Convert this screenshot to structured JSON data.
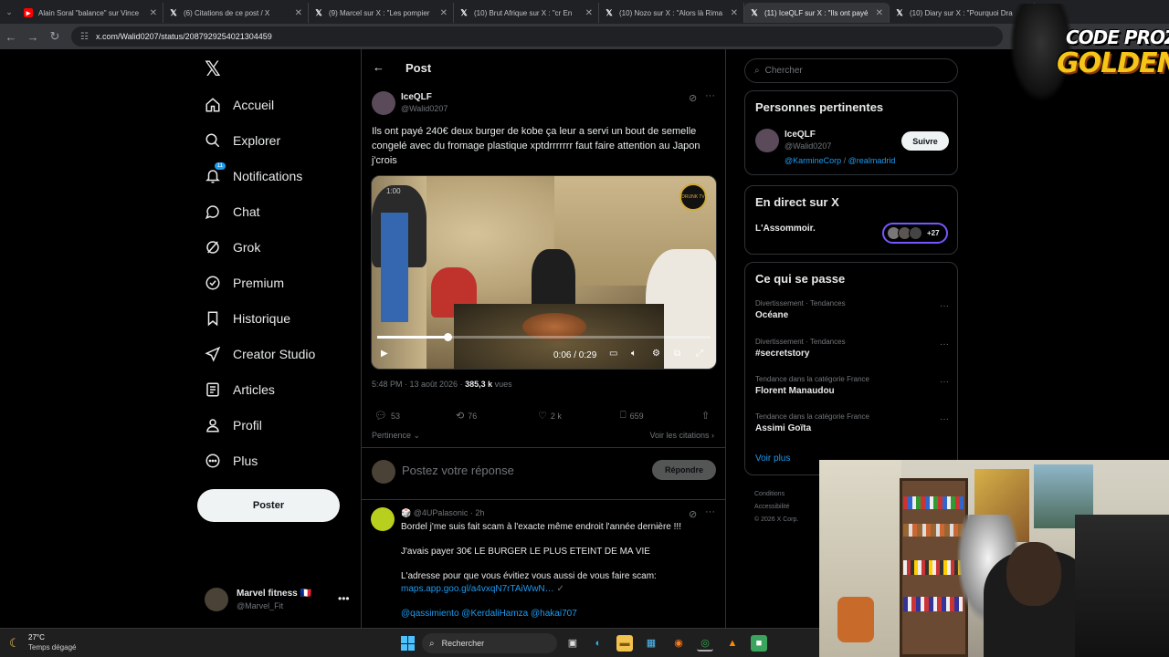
{
  "browser": {
    "tabs": [
      {
        "icon": "youtube-icon",
        "title": "Alain Soral \"balance\" sur Vince"
      },
      {
        "icon": "x-icon",
        "title": "(6) Citations de ce post / X"
      },
      {
        "icon": "x-icon",
        "title": "(9) Marcel sur X : \"Les pompier"
      },
      {
        "icon": "x-icon",
        "title": "(10) Brut Afrique sur X : \"cr En"
      },
      {
        "icon": "x-icon",
        "title": "(10) Nozo sur X : \"Alors là Rima"
      },
      {
        "icon": "x-icon",
        "title": "(11) IceQLF sur X : \"Ils ont payé",
        "active": true
      },
      {
        "icon": "x-icon",
        "title": "(10) Diary sur X : \"Pourquoi Dra"
      }
    ],
    "url": "x.com/Walid0207/status/2087929254021304459"
  },
  "nav": {
    "items": [
      {
        "label": "Accueil",
        "icon": "home-icon"
      },
      {
        "label": "Explorer",
        "icon": "search-icon"
      },
      {
        "label": "Notifications",
        "icon": "bell-icon",
        "badge": "11"
      },
      {
        "label": "Chat",
        "icon": "chat-icon"
      },
      {
        "label": "Grok",
        "icon": "grok-icon"
      },
      {
        "label": "Premium",
        "icon": "verified-icon"
      },
      {
        "label": "Historique",
        "icon": "bookmark-icon"
      },
      {
        "label": "Creator Studio",
        "icon": "rocket-icon"
      },
      {
        "label": "Articles",
        "icon": "article-icon"
      },
      {
        "label": "Profil",
        "icon": "person-icon"
      },
      {
        "label": "Plus",
        "icon": "more-circle-icon"
      }
    ],
    "post_button": "Poster",
    "account": {
      "name": "Marvel fitness 🇫🇷",
      "handle": "@Marvel_Fit"
    }
  },
  "post": {
    "header_title": "Post",
    "author": {
      "name": "IceQLF",
      "handle": "@Walid0207"
    },
    "text": "Ils ont payé 240€ deux burger de kobe ça leur a servi un bout de semelle congelé avec du fromage plastique xptdrrrrrrr faut faire attention au Japon j'crois",
    "video": {
      "overlay_time": "1:00",
      "timecode": "0:06 / 0:29",
      "progress": 0.21,
      "logo_text": "DRUNK TV"
    },
    "meta": {
      "time": "5:48 PM · 13 août 2026 · ",
      "views": "385,3 k",
      "views_suffix": " vues"
    },
    "actions": {
      "replies": "53",
      "reposts": "76",
      "likes": "2 k",
      "bookmarks": "659"
    },
    "relevance": "Pertinence",
    "quotes_link": "Voir les citations",
    "reply_placeholder": "Postez votre réponse",
    "reply_button": "Répondre"
  },
  "reply": {
    "handle": "🎲 @4UPalasonic · 2h",
    "line1": "Bordel j'me suis fait scam à l'exacte même endroit l'année dernière !!!",
    "line2": "J'avais payer 30€ LE BURGER LE PLUS ETEINT DE MA VIE",
    "line3": "L'adresse pour que vous évitiez vous aussi de vous faire scam:",
    "link": "maps.app.goo.gl/a4vxqN7rTAiWwN…",
    "mentions": "@qassimiento @KerdaliHamza @hakai707"
  },
  "sidebar": {
    "search_placeholder": "Chercher",
    "relevant": {
      "title": "Personnes pertinentes",
      "name": "IceQLF",
      "handle": "@Walid0207",
      "bio_link1": "@KarmineCorp",
      "bio_sep": " / ",
      "bio_link2": "@realmadrid",
      "follow": "Suivre"
    },
    "live": {
      "title": "En direct sur X",
      "name": "L'Assommoir.",
      "count": "+27"
    },
    "trends": {
      "title": "Ce qui se passe",
      "items": [
        {
          "category": "Divertissement · Tendances",
          "name": "Océane"
        },
        {
          "category": "Divertissement · Tendances",
          "name": "#secretstory"
        },
        {
          "category": "Tendance dans la catégorie France",
          "name": "Florent Manaudou"
        },
        {
          "category": "Tendance dans la catégorie France",
          "name": "Assimi Goïta"
        }
      ],
      "see_more": "Voir plus"
    },
    "footer": [
      "Conditions",
      "Accessibilité",
      "© 2026 X Corp."
    ]
  },
  "overlay": {
    "brand_line1": "CODE PROZIS",
    "brand_line2": "GOLDENG"
  },
  "taskbar": {
    "temp": "27°C",
    "weather": "Temps dégagé",
    "search": "Rechercher"
  },
  "colors": {
    "accent": "#1d9bf0",
    "live_border": "#7856ff",
    "background": "#000000"
  }
}
